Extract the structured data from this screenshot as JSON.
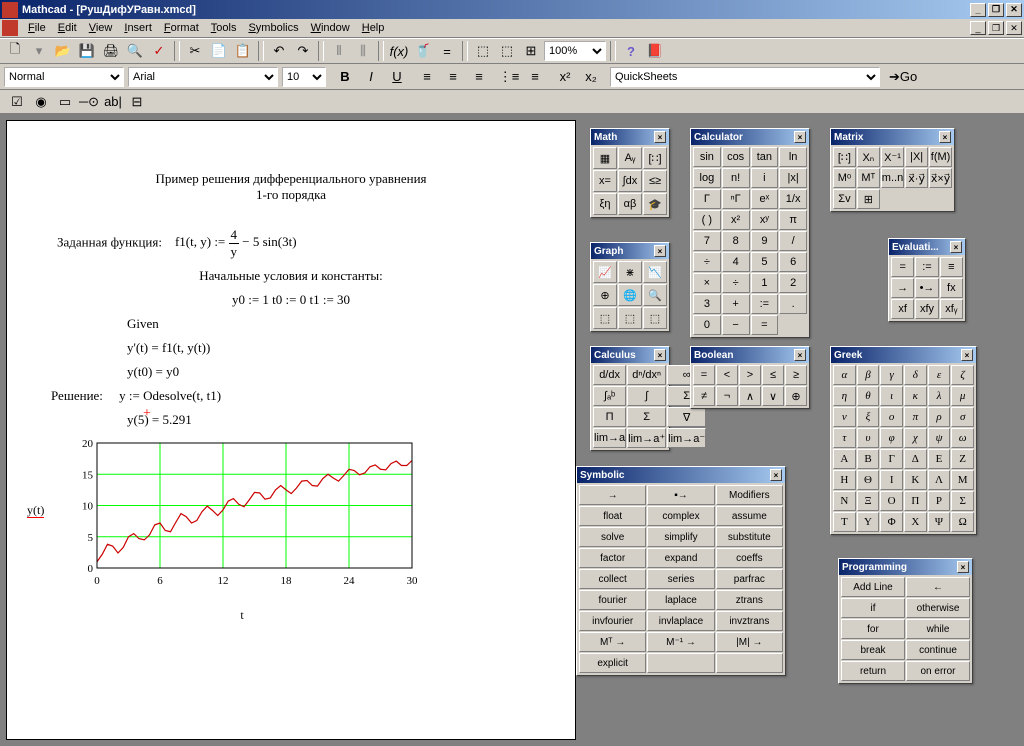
{
  "app": {
    "title": "Mathcad - [РушДифУРавн.xmcd]"
  },
  "menu": [
    "File",
    "Edit",
    "View",
    "Insert",
    "Format",
    "Tools",
    "Symbolics",
    "Window",
    "Help"
  ],
  "toolbar1": {
    "zoom": "100%"
  },
  "toolbar2": {
    "style": "Normal",
    "font": "Arial",
    "size": "10",
    "quicksheets": "QuickSheets",
    "go": "Go"
  },
  "doc": {
    "title1": "Пример решения дифференциального уравнения",
    "title2": "1-го порядка",
    "l1a": "Заданная функция:",
    "l1b": "f1(t, y) := 4/y − 5 sin(3t)",
    "l2": "Начальные условия и константы:",
    "l3": "y0 := 1     t0 := 0      t1 := 30",
    "l4": "Given",
    "l5": "y'(t) = f1(t, y(t))",
    "l6": "y(t0) = y0",
    "l7a": "Решение:",
    "l7b": "y := Odesolve(t, t1)",
    "l8": "y(5) = 5.291",
    "ylabel": "y(t)",
    "xlabel": "t"
  },
  "chart_data": {
    "type": "line",
    "xlabel": "t",
    "ylabel": "y(t)",
    "xlim": [
      0,
      30
    ],
    "ylim": [
      0,
      20
    ],
    "xticks": [
      0,
      6,
      12,
      18,
      24,
      30
    ],
    "yticks": [
      0,
      5,
      10,
      15,
      20
    ],
    "grid": true,
    "grid_color": "#00ff00",
    "series": [
      {
        "name": "y(t)",
        "color": "#cc0000",
        "x": [
          0,
          0.5,
          1,
          1.5,
          2,
          2.5,
          3,
          3.5,
          4,
          4.5,
          5,
          5.5,
          6,
          6.5,
          7,
          7.5,
          8,
          8.5,
          9,
          9.5,
          10,
          10.5,
          11,
          11.5,
          12,
          12.5,
          13,
          13.5,
          14,
          14.5,
          15,
          15.5,
          16,
          16.5,
          17,
          17.5,
          18,
          18.5,
          19,
          19.5,
          20,
          20.5,
          21,
          21.5,
          22,
          22.5,
          23,
          23.5,
          24,
          24.5,
          25,
          25.5,
          26,
          26.5,
          27,
          27.5,
          28,
          28.5,
          29,
          29.5,
          30
        ],
        "y": [
          1.0,
          2.2,
          3.8,
          3.5,
          2.4,
          3.3,
          5.0,
          5.5,
          4.7,
          4.5,
          5.3,
          6.9,
          7.2,
          6.0,
          5.8,
          7.3,
          8.7,
          8.2,
          7.2,
          7.6,
          9.0,
          9.9,
          9.2,
          8.4,
          9.3,
          10.7,
          11.1,
          10.2,
          9.8,
          10.9,
          12.1,
          12.0,
          11.0,
          11.2,
          12.5,
          13.2,
          12.5,
          11.9,
          12.8,
          13.9,
          14.0,
          13.2,
          13.1,
          14.3,
          15.0,
          14.4,
          13.9,
          14.8,
          15.8,
          15.6,
          14.9,
          15.2,
          16.2,
          16.5,
          15.8,
          15.7,
          16.7,
          17.1,
          16.4,
          16.4,
          17.2
        ]
      }
    ]
  },
  "palettes": {
    "math": {
      "title": "Math",
      "cells": [
        "▦",
        "Aᵧ",
        "[∷]",
        "x=",
        "∫dx",
        "≤≥",
        "ξη",
        "αβ",
        "🎓"
      ]
    },
    "graph": {
      "title": "Graph",
      "cells": [
        "📈",
        "⋇",
        "📉",
        "⊕",
        "🌐",
        "🔍",
        "⬚",
        "⬚",
        "⬚"
      ]
    },
    "calculus": {
      "title": "Calculus",
      "cells": [
        "d/dx",
        "dⁿ/dxⁿ",
        "∞",
        "∫ₐᵇ",
        "∫",
        "Σ",
        "Π",
        "Σ",
        "∇",
        "lim→a",
        "lim→a⁺",
        "lim→a⁻"
      ]
    },
    "calculator": {
      "title": "Calculator",
      "cells": [
        "sin",
        "cos",
        "tan",
        "ln",
        "log",
        "n!",
        "i",
        "|x|",
        "Γ",
        "ⁿΓ",
        "eˣ",
        "1/x",
        "( )",
        "x²",
        "xʸ",
        "π",
        "7",
        "8",
        "9",
        "/",
        "÷",
        "4",
        "5",
        "6",
        "×",
        "÷",
        "1",
        "2",
        "3",
        "+",
        ":=",
        ".",
        "0",
        "−",
        "="
      ]
    },
    "boolean": {
      "title": "Boolean",
      "cells": [
        "=",
        "<",
        ">",
        "≤",
        "≥",
        "≠",
        "¬",
        "∧",
        "∨",
        "⊕"
      ]
    },
    "symbolic": {
      "title": "Symbolic",
      "cells": [
        "→",
        "▪→",
        "Modifiers",
        "float",
        "complex",
        "assume",
        "solve",
        "simplify",
        "substitute",
        "factor",
        "expand",
        "coeffs",
        "collect",
        "series",
        "parfrac",
        "fourier",
        "laplace",
        "ztrans",
        "invfourier",
        "invlaplace",
        "invztrans",
        "Mᵀ →",
        "M⁻¹ →",
        "|M| →",
        "explicit",
        "",
        ""
      ]
    },
    "matrix": {
      "title": "Matrix",
      "cells": [
        "[∷]",
        "Xₙ",
        "X⁻¹",
        "|X|",
        "f(M)",
        "Mᵒ",
        "Mᵀ",
        "m..n",
        "x⃗·y⃗",
        "x⃗×y⃗",
        "Σv",
        "⊞"
      ]
    },
    "eval": {
      "title": "Evaluati...",
      "cells": [
        "=",
        ":=",
        "≡",
        "→",
        "•→",
        "fx",
        "xf",
        "xfy",
        "xfᵧ"
      ]
    },
    "greek": {
      "title": "Greek",
      "lower": [
        "α",
        "β",
        "γ",
        "δ",
        "ε",
        "ζ",
        "η",
        "θ",
        "ι",
        "κ",
        "λ",
        "μ",
        "ν",
        "ξ",
        "ο",
        "π",
        "ρ",
        "σ",
        "τ",
        "υ",
        "φ",
        "χ",
        "ψ",
        "ω"
      ],
      "upper": [
        "Α",
        "Β",
        "Γ",
        "Δ",
        "Ε",
        "Ζ",
        "Η",
        "Θ",
        "Ι",
        "Κ",
        "Λ",
        "Μ",
        "Ν",
        "Ξ",
        "Ο",
        "Π",
        "Ρ",
        "Σ",
        "Τ",
        "Υ",
        "Φ",
        "Χ",
        "Ψ",
        "Ω"
      ]
    },
    "prog": {
      "title": "Programming",
      "cells": [
        "Add Line",
        "←",
        "if",
        "otherwise",
        "for",
        "while",
        "break",
        "continue",
        "return",
        "on error"
      ]
    }
  }
}
